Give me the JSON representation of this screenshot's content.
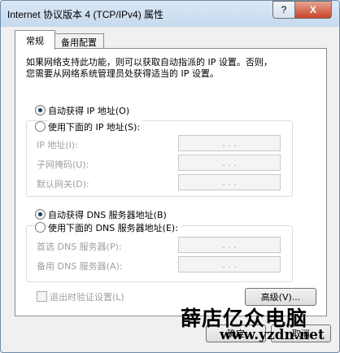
{
  "window": {
    "title": "Internet 协议版本 4 (TCP/IPv4) 属性",
    "help_glyph": "?",
    "close_glyph": "X"
  },
  "tabs": [
    "常规",
    "备用配置"
  ],
  "description_lines": [
    "如果网络支持此功能，则可以获取自动指派的 IP 设置。否则，",
    "您需要从网络系统管理员处获得适当的 IP 设置。"
  ],
  "ip_section": {
    "auto_label": "自动获得 IP 地址(O)",
    "manual_label": "使用下面的 IP 地址(S):",
    "selected": "auto",
    "fields": [
      {
        "label": "IP 地址(I):",
        "value": ". . ."
      },
      {
        "label": "子网掩码(U):",
        "value": ". . ."
      },
      {
        "label": "默认网关(D):",
        "value": ". . ."
      }
    ]
  },
  "dns_section": {
    "auto_label": "自动获得 DNS 服务器地址(B)",
    "manual_label": "使用下面的 DNS 服务器地址(E):",
    "selected": "auto",
    "fields": [
      {
        "label": "首选 DNS 服务器(P):",
        "value": ". . ."
      },
      {
        "label": "备用 DNS 服务器(A):",
        "value": ". . ."
      }
    ]
  },
  "validate_label": "退出时验证设置(L)",
  "advanced_label": "高级(V)...",
  "ok_label": "确定",
  "cancel_label": "取消",
  "watermark": {
    "line1": "薛店亿众电脑",
    "line2": "www.yzdn.net"
  }
}
